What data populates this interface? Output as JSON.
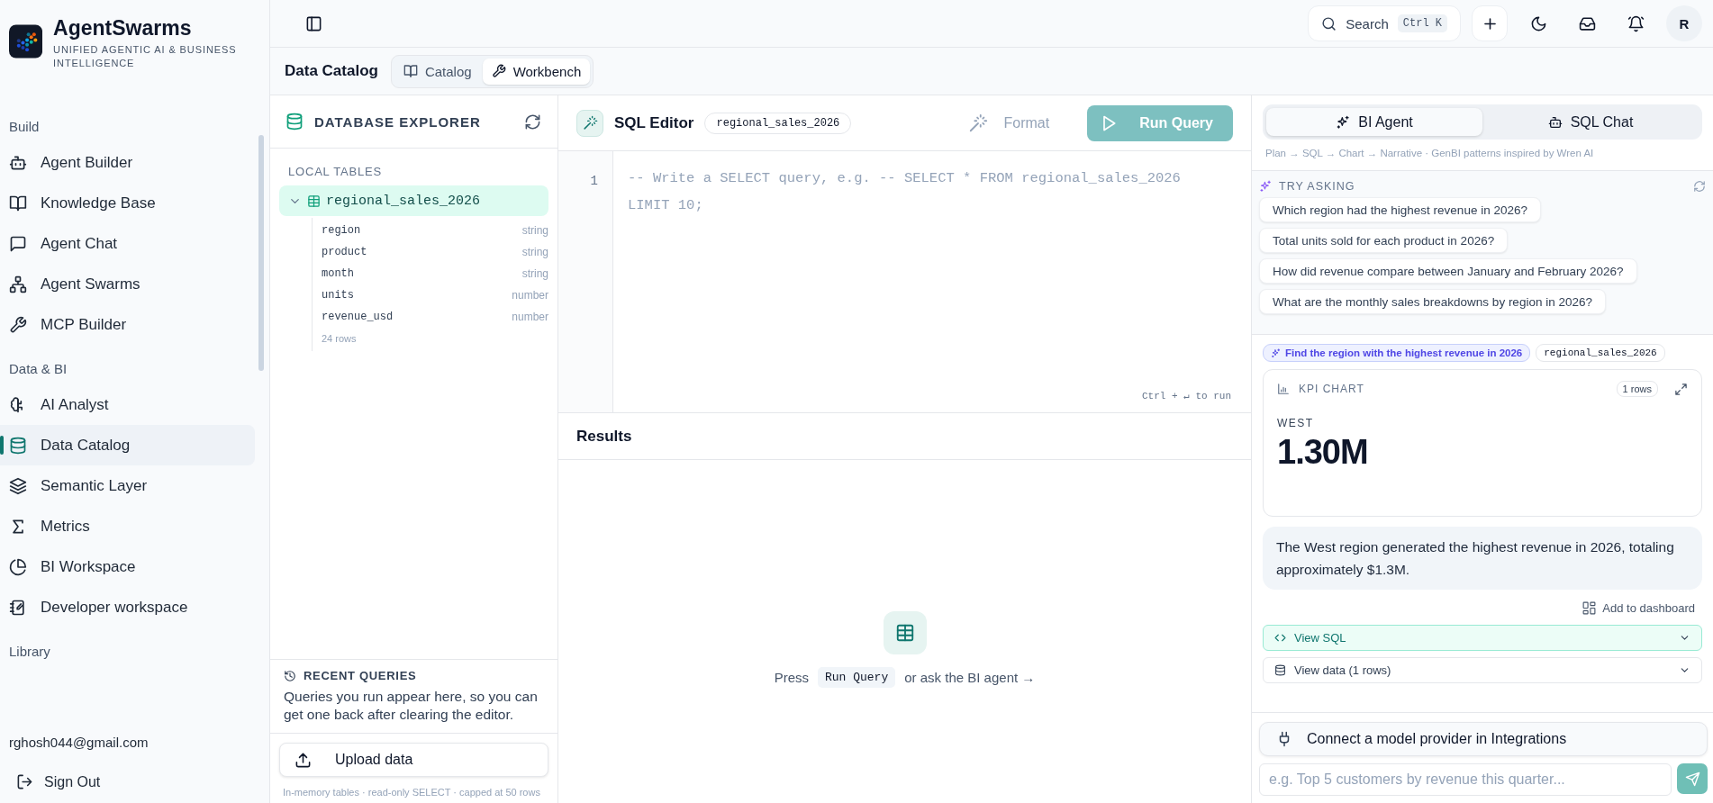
{
  "brand": {
    "name": "AgentSwarms",
    "tagline": "UNIFIED AGENTIC AI & BUSINESS INTELLIGENCE"
  },
  "sidebar": {
    "sections": [
      {
        "title": "Build",
        "items": [
          {
            "label": "Agent Builder",
            "selected": false
          },
          {
            "label": "Knowledge Base",
            "selected": false
          },
          {
            "label": "Agent Chat",
            "selected": false
          },
          {
            "label": "Agent Swarms",
            "selected": false
          },
          {
            "label": "MCP Builder",
            "selected": false
          }
        ]
      },
      {
        "title": "Data & BI",
        "items": [
          {
            "label": "AI Analyst",
            "selected": false
          },
          {
            "label": "Data Catalog",
            "selected": true
          },
          {
            "label": "Semantic Layer",
            "selected": false
          },
          {
            "label": "Metrics",
            "selected": false
          },
          {
            "label": "BI Workspace",
            "selected": false
          },
          {
            "label": "Developer workspace",
            "selected": false
          }
        ]
      },
      {
        "title": "Library"
      }
    ],
    "user_email": "rghosh044@gmail.com",
    "sign_out": "Sign Out"
  },
  "topbar": {
    "search": {
      "label": "Search",
      "shortcut": "Ctrl K"
    },
    "avatar": "R"
  },
  "page": {
    "title": "Data Catalog",
    "tabs": [
      {
        "label": "Catalog",
        "selected": false
      },
      {
        "label": "Workbench",
        "selected": true
      }
    ]
  },
  "explorer": {
    "title": "DATABASE EXPLORER",
    "section": "LOCAL TABLES",
    "tables": [
      {
        "name": "regional_sales_2026",
        "selected": true,
        "expanded": true,
        "row_count": "24 rows",
        "columns": [
          {
            "name": "region",
            "type": "string"
          },
          {
            "name": "product",
            "type": "string"
          },
          {
            "name": "month",
            "type": "string"
          },
          {
            "name": "units",
            "type": "number"
          },
          {
            "name": "revenue_usd",
            "type": "number"
          }
        ]
      }
    ],
    "recent": {
      "title": "RECENT QUERIES",
      "text": "Queries you run appear here, so you can get one back after clearing the editor."
    },
    "upload": "Upload data",
    "footnote": "In-memory tables · read-only SELECT · capped at 50 rows"
  },
  "editor": {
    "title": "SQL Editor",
    "table": "regional_sales_2026",
    "format": "Format",
    "run": "Run Query",
    "run_disabled": true,
    "line_numbers": [
      "1"
    ],
    "placeholder": "-- Write a SELECT query, e.g. -- SELECT * FROM regional_sales_2026 LIMIT 10;",
    "hint": "Ctrl + ↵ to run"
  },
  "results": {
    "title": "Results",
    "empty": {
      "before": "Press",
      "key": "Run Query",
      "after": "or ask the BI agent →"
    }
  },
  "assistant": {
    "tabs": [
      {
        "label": "BI Agent",
        "selected": true
      },
      {
        "label": "SQL Chat",
        "selected": false
      }
    ],
    "subtitle": "Plan → SQL → Chart → Narrative · GenBI patterns inspired by Wren AI",
    "suggestions": {
      "title": "TRY ASKING",
      "items": [
        "Which region had the highest revenue in 2026?",
        "Total units sold for each product in 2026?",
        "How did revenue compare between January and February 2026?",
        "What are the monthly sales breakdowns by region in 2026?"
      ]
    },
    "question": "Find the region with the highest revenue in 2026",
    "question_table": "regional_sales_2026",
    "kpi": {
      "title": "KPI CHART",
      "rows": "1 rows",
      "label": "WEST",
      "value": "1.30M"
    },
    "answer": "The West region generated the highest revenue in 2026, totaling approximately $1.3M.",
    "add_to_dashboard": "Add to dashboard",
    "disclosures": [
      {
        "label": "View SQL",
        "highlighted": true
      },
      {
        "label": "View data (1 rows)",
        "highlighted": false
      }
    ],
    "connect": "Connect a model provider in Integrations",
    "input": {
      "placeholder": "e.g. Top 5 customers by revenue this quarter..."
    }
  }
}
